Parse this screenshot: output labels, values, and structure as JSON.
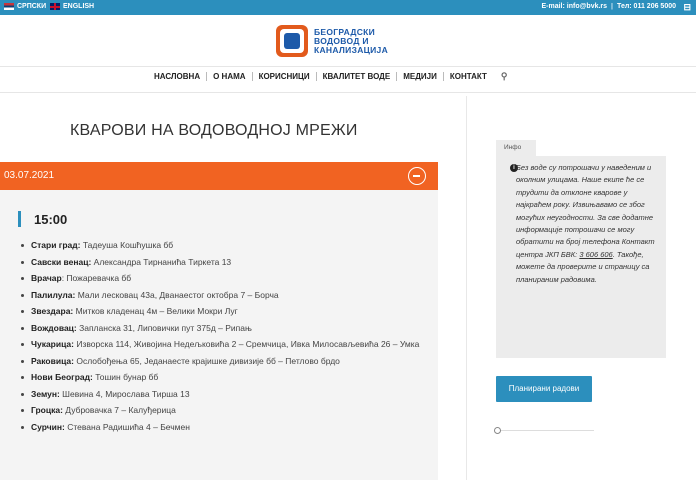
{
  "topbar": {
    "lang_sr": "СРПСКИ",
    "lang_en": "ENGLISH",
    "email": "E-mail: info@bvk.rs",
    "separator": "|",
    "phone": "Тел: 011 206 5000",
    "colors": {
      "background": "#2c8fbd"
    }
  },
  "logo": {
    "line1": "БЕОГРАДСКИ",
    "line2": "ВОДОВОД И",
    "line3": "КАНАЛИЗАЦИЈА"
  },
  "nav": {
    "items": [
      "НАСЛОВНА",
      "О НАМА",
      "КОРИСНИЦИ",
      "КВАЛИТЕТ ВОДЕ",
      "МЕДИЈИ",
      "КОНТАКТ"
    ],
    "search_icon": "search-icon"
  },
  "page": {
    "title": "КВАРОВИ НА ВОДОВОДНОЈ МРЕЖИ",
    "date": "03.07.2021",
    "time": "15:00",
    "colors": {
      "accent": "#f16322",
      "blue": "#2c8fbd"
    }
  },
  "outages": [
    {
      "area": "Стари град:",
      "streets": " Тадеуша Кошћушка бб"
    },
    {
      "area": "Савски венац:",
      "streets": " Александра Тирнанића Тиркета 13"
    },
    {
      "area": "Врачар",
      "streets": ": Пожаревачка бб"
    },
    {
      "area": "Палилула:",
      "streets": " Мали лесковац 43а, Дванаестог октобра 7 – Борча"
    },
    {
      "area": "Звездара:",
      "streets": " Митков кладенац 4м – Велики Мокри Луг"
    },
    {
      "area": "Вождовац:",
      "streets": " Запланска 31, Липовички пут 375д – Рипањ"
    },
    {
      "area": "Чукарица:",
      "streets": " Изворска 114, Живојина Недељковића 2 – Сремчица, Ивка Милосављевића 26 – Умка"
    },
    {
      "area": "Раковица:",
      "streets": " Ослобођења 65, Једанаесте крајишке дивизије бб – Петлово брдо"
    },
    {
      "area": "Нови Београд:",
      "streets": " Тошин бунар бб"
    },
    {
      "area": "Земун:",
      "streets": " Шевина 4, Мирослава Тирша 13"
    },
    {
      "area": "Гроцка:",
      "streets": " Дубровачка 7 – Калуђерица"
    },
    {
      "area": "Сурчин:",
      "streets": " Стевана Радишића 4 – Бечмен"
    }
  ],
  "sidebar": {
    "info_tab": "Инфо",
    "info_text_1": "Без воде су потрошачи у наведеним и околним улицама. Наше екипе ће се трудити да отклоне кварове у најкраћем року. Извињавамо се због могућих неугодности. За све додатне информације потрошачи се могу обратити на број телефона Контакт центра ЈКП БВК: ",
    "info_phone": "3 606 606",
    "info_text_2": ". Такође, можете да проверите и страницу са планираним радовима.",
    "button_label": "Планирани радови"
  }
}
